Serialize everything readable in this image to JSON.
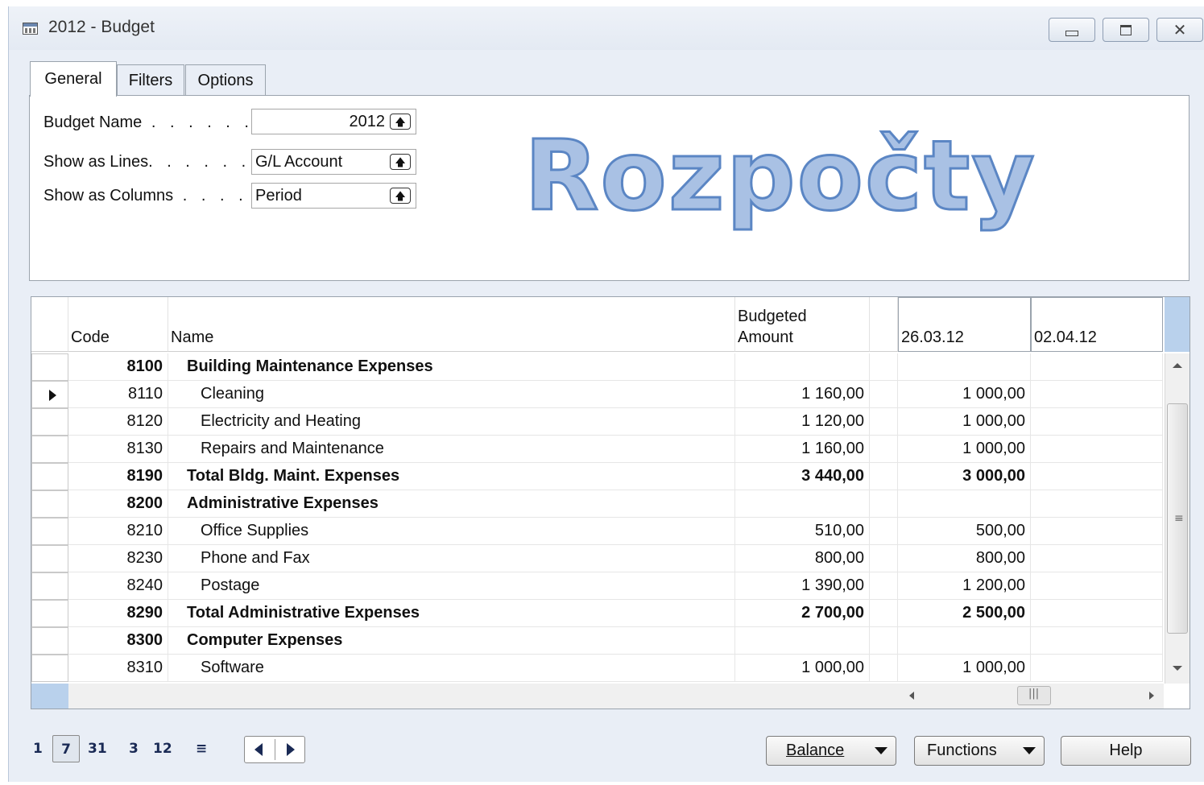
{
  "window": {
    "title": "2012 - Budget",
    "icon": "table-icon"
  },
  "controls": {
    "minimize": "minimize-icon",
    "maximize": "maximize-icon",
    "close": "close-icon"
  },
  "tabs": [
    {
      "label": "General"
    },
    {
      "label": "Filters"
    },
    {
      "label": "Options"
    }
  ],
  "general": {
    "budget_name": {
      "label": "Budget Name",
      "value": "2012"
    },
    "show_as_lines": {
      "label": "Show as Lines",
      "value": "G/L Account"
    },
    "show_as_columns": {
      "label": "Show as Columns",
      "value": "Period"
    }
  },
  "watermark": "Rozpočty",
  "grid": {
    "headers": {
      "code": "Code",
      "name": "Name",
      "budgeted_line1": "Budgeted",
      "budgeted_line2": "Amount",
      "col1": "26.03.12",
      "col2": "02.04.12"
    },
    "rows": [
      {
        "code": "8100",
        "name": "Building Maintenance Expenses",
        "amount": "",
        "col1": "",
        "col2": "",
        "bold": true,
        "current": false
      },
      {
        "code": "8110",
        "name": "Cleaning",
        "amount": "1 160,00",
        "col1": "1 000,00",
        "col2": "",
        "bold": false,
        "current": true
      },
      {
        "code": "8120",
        "name": "Electricity and Heating",
        "amount": "1 120,00",
        "col1": "1 000,00",
        "col2": "",
        "bold": false,
        "current": false
      },
      {
        "code": "8130",
        "name": "Repairs and Maintenance",
        "amount": "1 160,00",
        "col1": "1 000,00",
        "col2": "",
        "bold": false,
        "current": false
      },
      {
        "code": "8190",
        "name": "Total Bldg. Maint. Expenses",
        "amount": "3 440,00",
        "col1": "3 000,00",
        "col2": "",
        "bold": true,
        "current": false
      },
      {
        "code": "8200",
        "name": "Administrative Expenses",
        "amount": "",
        "col1": "",
        "col2": "",
        "bold": true,
        "current": false
      },
      {
        "code": "8210",
        "name": "Office Supplies",
        "amount": "510,00",
        "col1": "500,00",
        "col2": "",
        "bold": false,
        "current": false
      },
      {
        "code": "8230",
        "name": "Phone and Fax",
        "amount": "800,00",
        "col1": "800,00",
        "col2": "",
        "bold": false,
        "current": false
      },
      {
        "code": "8240",
        "name": "Postage",
        "amount": "1 390,00",
        "col1": "1 200,00",
        "col2": "",
        "bold": false,
        "current": false
      },
      {
        "code": "8290",
        "name": "Total Administrative Expenses",
        "amount": "2 700,00",
        "col1": "2 500,00",
        "col2": "",
        "bold": true,
        "current": false
      },
      {
        "code": "8300",
        "name": "Computer Expenses",
        "amount": "",
        "col1": "",
        "col2": "",
        "bold": true,
        "current": false
      },
      {
        "code": "8310",
        "name": "Software",
        "amount": "1 000,00",
        "col1": "1 000,00",
        "col2": "",
        "bold": false,
        "current": false
      }
    ]
  },
  "pager": {
    "items": [
      "1",
      "7",
      "31",
      "3",
      "12"
    ],
    "selected": "7",
    "more": "≡"
  },
  "buttons": {
    "balance": "Balance",
    "functions": "Functions",
    "help": "Help"
  }
}
